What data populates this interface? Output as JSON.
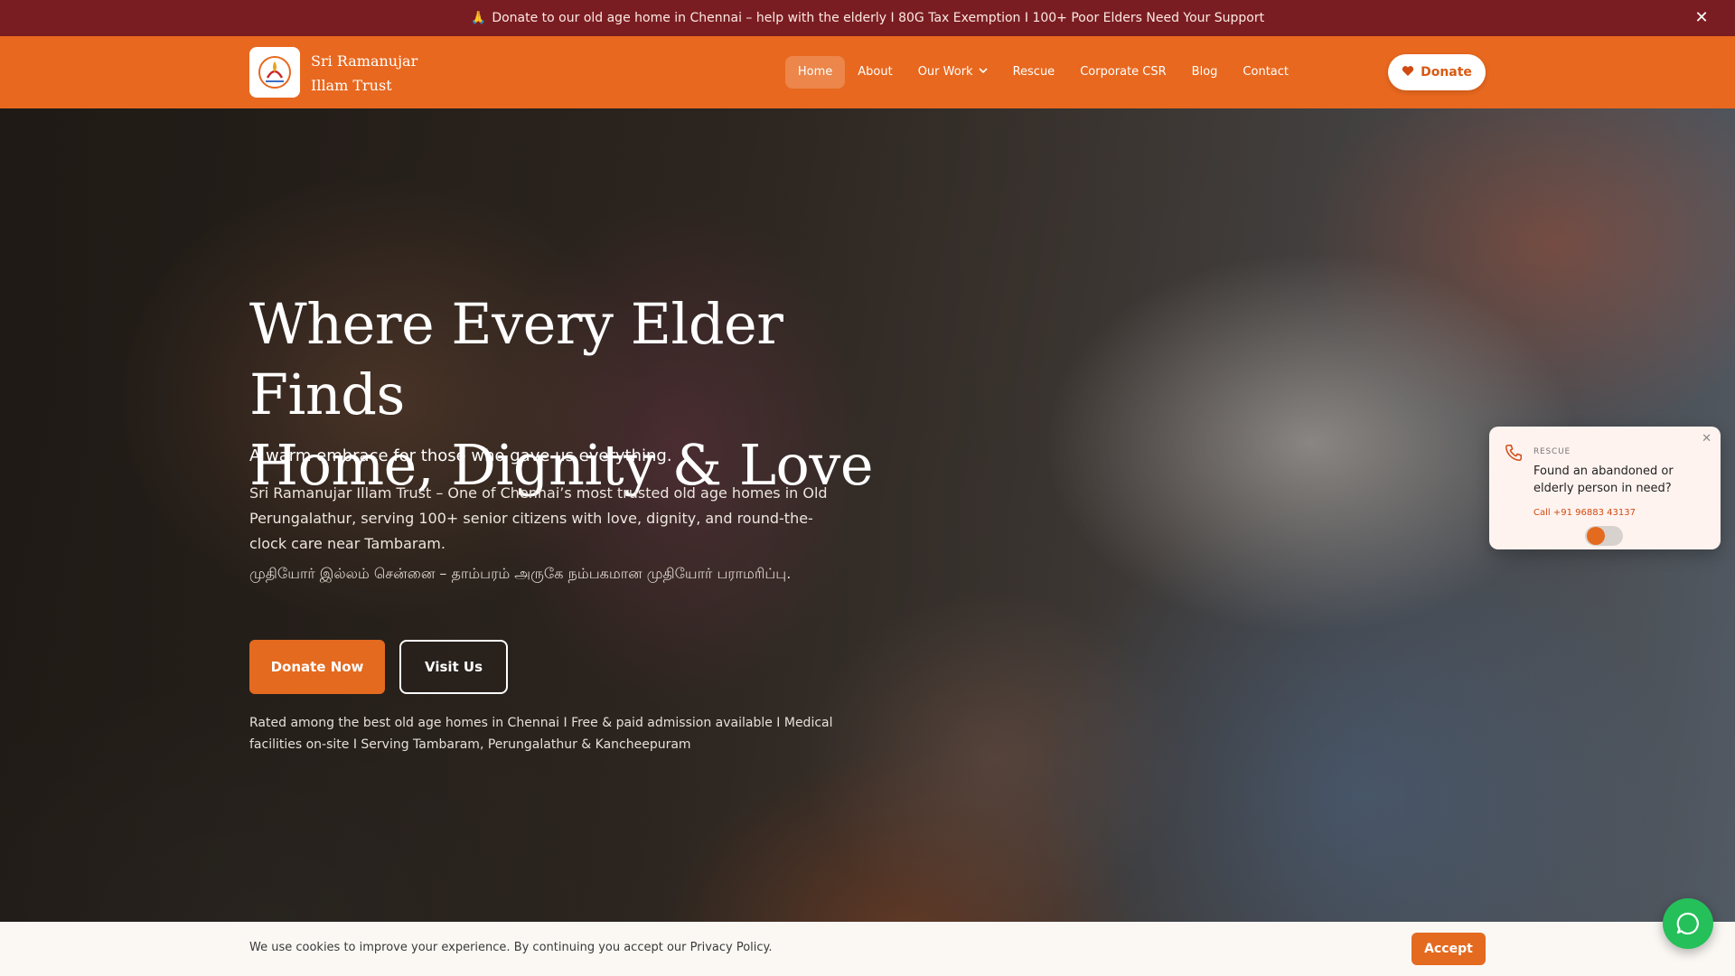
{
  "announcement": {
    "icon": "praying-hands-icon",
    "text": "Donate to our old age home in Chennai – help with the elderly I 80G Tax Exemption I 100+ Poor Elders Need Your Support",
    "close_glyph": "✕"
  },
  "header": {
    "brand_line1": "Sri Ramanujar",
    "brand_line2": "Illam Trust",
    "nav": [
      {
        "label": "Home",
        "active": true
      },
      {
        "label": "About"
      },
      {
        "label": "Our Work",
        "dropdown": true
      },
      {
        "label": "Rescue"
      },
      {
        "label": "Corporate CSR"
      },
      {
        "label": "Blog"
      },
      {
        "label": "Contact"
      }
    ],
    "donate_label": "Donate"
  },
  "hero": {
    "title_line1": "Where Every Elder Finds",
    "title_line2": "Home, Dignity & Love",
    "tagline": "A warm embrace for those who gave us everything.",
    "description": "Sri Ramanujar Illam Trust – One of Chennai’s most trusted old age homes in Old Perungalathur, serving 100+ senior citizens with love, dignity, and round-the-clock care near Tambaram.",
    "tamil": "முதியோர் இல்லம் சென்னை – தாம்பரம் அருகே நம்பகமான முதியோர் பராமரிப்பு.",
    "donate_now": "Donate Now",
    "visit_us": "Visit Us",
    "note": "Rated among the best old age homes in Chennai I Free & paid admission available I Medical facilities on-site I Serving Tambaram, Perungalathur & Kancheepuram"
  },
  "rescue_popup": {
    "tag": "RESCUE",
    "question": "Found an abandoned or elderly person in need?",
    "call": "Call +91 96883 43137",
    "close_glyph": "✕"
  },
  "cookie": {
    "message": "We use cookies to improve your experience. By continuing you accept our Privacy Policy.",
    "accept": "Accept"
  },
  "colors": {
    "announcement_bg": "#7a1d22",
    "header_bg": "#e8681f",
    "accent": "#e46a1f",
    "whatsapp": "#25c05a"
  }
}
